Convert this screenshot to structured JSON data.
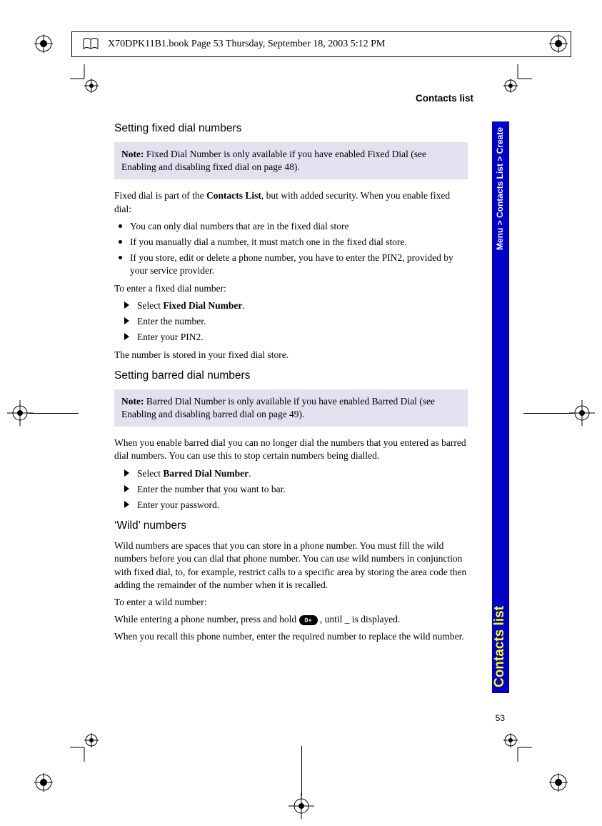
{
  "header": "X70DPK11B1.book  Page 53  Thursday, September 18, 2003  5:12 PM",
  "section_label": "Contacts list",
  "sidebar": {
    "breadcrumb": "Menu > Contacts List > Create",
    "title": "Contacts list"
  },
  "page_number": "53",
  "s1": {
    "heading": "Setting fixed dial numbers",
    "note_lead": "Note:",
    "note_body": " Fixed Dial Number is only available if you have enabled Fixed Dial (see Enabling and disabling fixed dial on page 48).",
    "intro_a": "Fixed dial is part of the ",
    "intro_bold": "Contacts List",
    "intro_b": ", but with added security. When you enable fixed dial:",
    "bullets": [
      "You can only dial numbers that are in the fixed dial store",
      "If you manually dial a number, it must match one in the fixed dial store.",
      "If you store, edit or delete a phone number, you have to enter the PIN2, provided by your service provider."
    ],
    "enter_line": "To enter a fixed dial number:",
    "steps": {
      "a_pre": "Select ",
      "a_bold": "Fixed Dial Number",
      "a_post": ".",
      "b": "Enter the number.",
      "c": "Enter your PIN2."
    },
    "outro": "The number is stored in your fixed dial store."
  },
  "s2": {
    "heading": "Setting barred dial numbers",
    "note_lead": "Note:",
    "note_body": " Barred Dial Number is only available if you have enabled Barred Dial (see Enabling and disabling barred dial on page 49).",
    "intro": "When you enable barred dial you can no longer dial the numbers that you entered as barred dial numbers. You can use this to stop certain numbers being dialled.",
    "steps": {
      "a_pre": "Select ",
      "a_bold": "Barred Dial Number",
      "a_post": ".",
      "b": "Enter the number that you want to bar.",
      "c": "Enter your password."
    }
  },
  "s3": {
    "heading": "‘Wild’ numbers",
    "p1": "Wild numbers are spaces that you can store in a phone number. You must fill the wild numbers before you can dial that phone number. You can use wild numbers in conjunction with fixed dial, to, for example, restrict calls to a specific area by storing the area code then adding the remainder of the number when it is recalled.",
    "p2": "To enter a wild number:",
    "p3a": "While entering a phone number, press and hold ",
    "key": "0+",
    "p3b": " , until _ is displayed.",
    "p4": "When you recall this phone number, enter the required number to replace the wild number."
  }
}
